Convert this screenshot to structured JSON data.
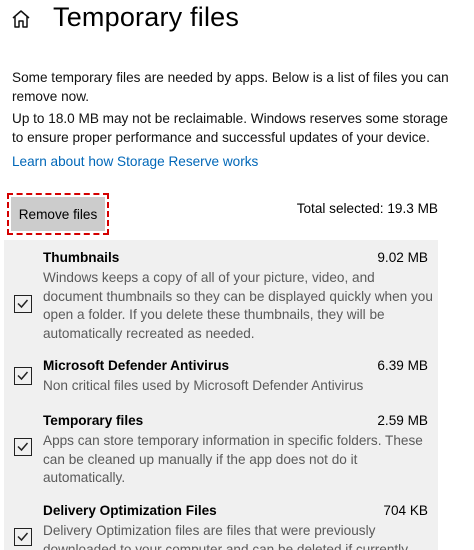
{
  "header": {
    "title": "Temporary files",
    "home_icon": "home-icon"
  },
  "intro": "Some temporary files are needed by apps. Below is a list of files you can remove now.",
  "reserve_note": "Up to 18.0 MB may not be reclaimable. Windows reserves some storage to ensure proper performance and successful updates of your device.",
  "learn_link": "Learn about how Storage Reserve works",
  "remove_button": "Remove files",
  "total_selected": "Total selected: 19.3 MB",
  "colors": {
    "link": "#0067b8",
    "highlight": "#d40000",
    "list_bg": "#f0f0f0"
  },
  "items": [
    {
      "title": "Thumbnails",
      "size": "9.02 MB",
      "checked": true,
      "description": "Windows keeps a copy of all of your picture, video, and document thumbnails so they can be displayed quickly when you open a folder. If you delete these thumbnails, they will be automatically recreated as needed."
    },
    {
      "title": "Microsoft Defender Antivirus",
      "size": "6.39 MB",
      "checked": true,
      "description": "Non critical files used by Microsoft Defender Antivirus"
    },
    {
      "title": "Temporary files",
      "size": "2.59 MB",
      "checked": true,
      "description": "Apps can store temporary information in specific folders. These can be cleaned up manually if the app does not do it automatically."
    },
    {
      "title": "Delivery Optimization Files",
      "size": "704 KB",
      "checked": true,
      "description": "Delivery Optimization files are files that were previously downloaded to your computer and can be deleted if currently"
    }
  ]
}
